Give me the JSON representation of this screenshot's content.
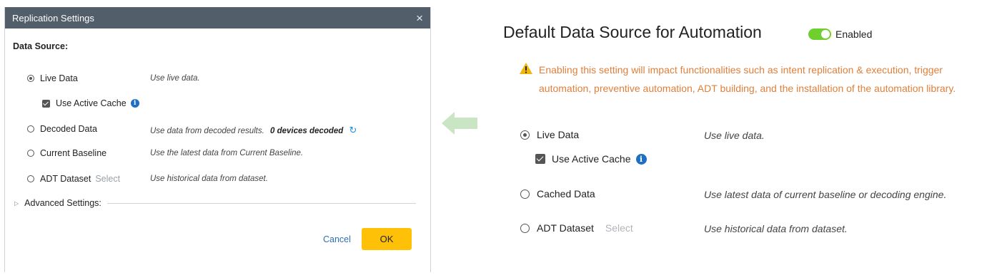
{
  "dialog": {
    "title": "Replication Settings",
    "close_glyph": "×",
    "section_title": "Data Source:",
    "options": {
      "live": {
        "label": "Live Data",
        "desc": "Use live data."
      },
      "cache": {
        "label": "Use Active Cache"
      },
      "decoded": {
        "label": "Decoded Data",
        "desc": "Use data from decoded results.",
        "devices": "0 devices decoded"
      },
      "baseline": {
        "label": "Current Baseline",
        "desc": "Use the latest data from Current Baseline."
      },
      "adt": {
        "label": "ADT Dataset",
        "select": "Select",
        "desc": "Use historical data from dataset."
      }
    },
    "advanced": "Advanced Settings:",
    "cancel": "Cancel",
    "ok": "OK"
  },
  "panel": {
    "title": "Default Data Source for Automation",
    "toggle_label": "Enabled",
    "warning_line1": "Enabling this setting will impact functionalities such as intent replication & execution, trigger",
    "warning_line2": "automation, preventive automation, ADT building, and the installation of the automation library.",
    "options": {
      "live": {
        "label": "Live Data",
        "desc": "Use live data."
      },
      "cache": {
        "label": "Use Active Cache"
      },
      "cached": {
        "label": "Cached Data",
        "desc": "Use latest data of current baseline or decoding engine."
      },
      "adt": {
        "label": "ADT Dataset",
        "select": "Select",
        "desc": "Use historical data from dataset."
      }
    }
  },
  "icons": {
    "info": "i",
    "refresh": "↻",
    "warning": "warning-triangle-icon",
    "arrow": "arrow-left-icon",
    "expand": "▷"
  },
  "colors": {
    "header_bg": "#525e6a",
    "accent_blue": "#1f6fc5",
    "ok_button": "#ffc107",
    "toggle_on": "#6fcf2e",
    "warning_text": "#e07f3a"
  }
}
